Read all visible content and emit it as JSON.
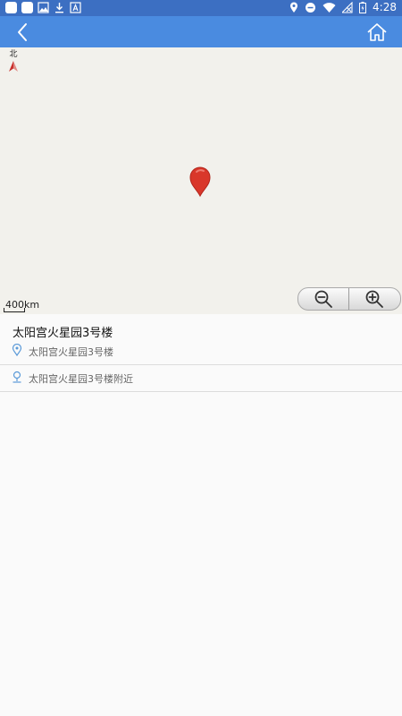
{
  "status_bar": {
    "time": "4:28",
    "icons": [
      "app-icon",
      "app-icon",
      "image-icon",
      "download-icon",
      "text-a-icon",
      "location-icon",
      "do-not-disturb-icon",
      "wifi-icon",
      "no-signal-icon",
      "battery-icon"
    ]
  },
  "app_bar": {
    "color": "#4a8be0",
    "left_icon": "back-arrow-icon",
    "right_icon": "home-icon"
  },
  "map": {
    "compass_label": "北",
    "scale_label": "400km",
    "zoom_out_icon": "zoom-out-icon",
    "zoom_in_icon": "zoom-in-icon",
    "pin_color": "#d9372a"
  },
  "place": {
    "title": "太阳宫火星园3号楼",
    "address": "太阳宫火星园3号楼",
    "nearby": "太阳宫火星园3号楼附近"
  }
}
